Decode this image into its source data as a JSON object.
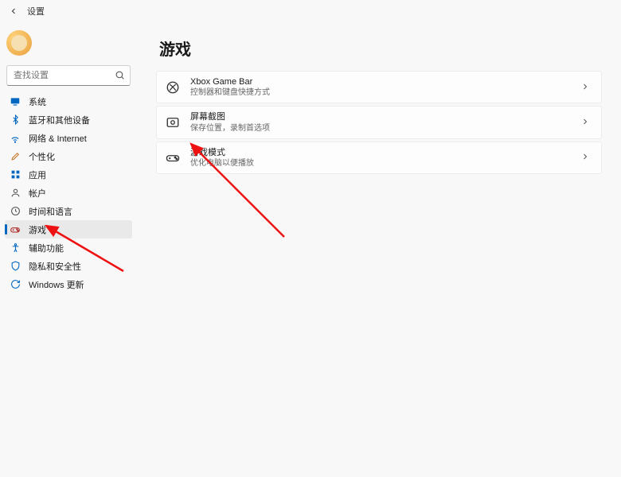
{
  "titlebar": {
    "label": "设置"
  },
  "search": {
    "placeholder": "查找设置"
  },
  "sidebar": {
    "items": [
      {
        "label": "系统"
      },
      {
        "label": "蓝牙和其他设备"
      },
      {
        "label": "网络 & Internet"
      },
      {
        "label": "个性化"
      },
      {
        "label": "应用"
      },
      {
        "label": "帐户"
      },
      {
        "label": "时间和语言"
      },
      {
        "label": "游戏"
      },
      {
        "label": "辅助功能"
      },
      {
        "label": "隐私和安全性"
      },
      {
        "label": "Windows 更新"
      }
    ]
  },
  "main": {
    "title": "游戏",
    "cards": [
      {
        "title": "Xbox Game Bar",
        "subtitle": "控制器和键盘快捷方式"
      },
      {
        "title": "屏幕截图",
        "subtitle": "保存位置，录制首选项"
      },
      {
        "title": "游戏模式",
        "subtitle": "优化电脑以便播放"
      }
    ]
  }
}
